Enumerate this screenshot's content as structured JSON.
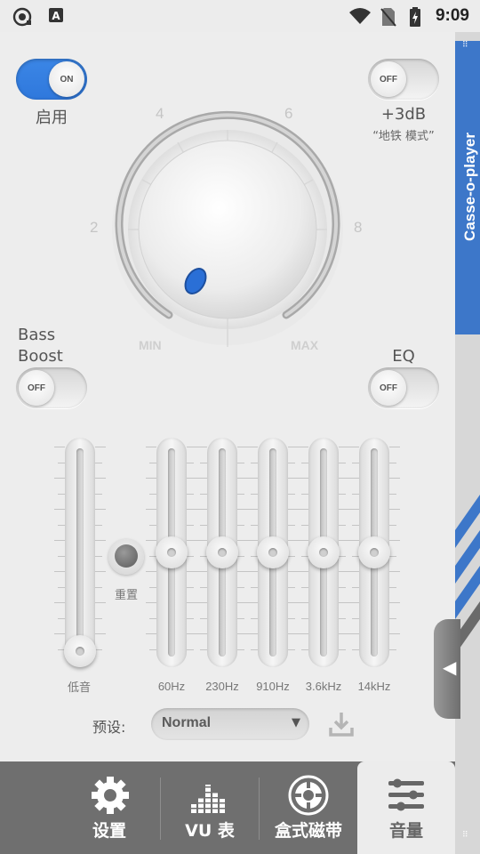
{
  "status_bar": {
    "time": "9:09",
    "icons": [
      "camera-settings-icon",
      "text-a-icon",
      "wifi-icon",
      "no-sim-icon",
      "battery-charging-icon"
    ]
  },
  "toggles": {
    "enable": {
      "state": "ON",
      "label": "启用"
    },
    "plus3db": {
      "state": "OFF",
      "label": "+3dB",
      "sublabel": "“地铁 模式”"
    },
    "bass_boost": {
      "state": "OFF",
      "label_line1": "Bass",
      "label_line2": "Boost"
    },
    "eq": {
      "state": "OFF",
      "label": "EQ"
    }
  },
  "volume_knob": {
    "scale_labels": [
      "2",
      "4",
      "6",
      "8"
    ],
    "min_label": "MIN",
    "max_label": "MAX"
  },
  "equalizer": {
    "bass_label": "低音",
    "bass_level": 0.0,
    "reset_label": "重置",
    "bands": [
      {
        "label": "60Hz",
        "level": 0.5
      },
      {
        "label": "230Hz",
        "level": 0.5
      },
      {
        "label": "910Hz",
        "level": 0.5
      },
      {
        "label": "3.6kHz",
        "level": 0.5
      },
      {
        "label": "14kHz",
        "level": 0.5
      }
    ]
  },
  "preset": {
    "label": "预设:",
    "value": "Normal"
  },
  "side_panel": {
    "title": "Casse-o-player"
  },
  "bottom_nav": {
    "items": [
      {
        "label": "设置",
        "icon": "gear-icon"
      },
      {
        "label": "VU 表",
        "icon": "vu-meter-icon"
      },
      {
        "label": "盒式磁带",
        "icon": "cassette-reel-icon"
      },
      {
        "label": "音量",
        "icon": "sliders-icon"
      }
    ],
    "active": "音量"
  },
  "colors": {
    "accent": "#2f78dc",
    "side_band": "#3d77c9",
    "nav_bg": "#6f6f6f",
    "knob_dot": "#2a6fd6"
  }
}
